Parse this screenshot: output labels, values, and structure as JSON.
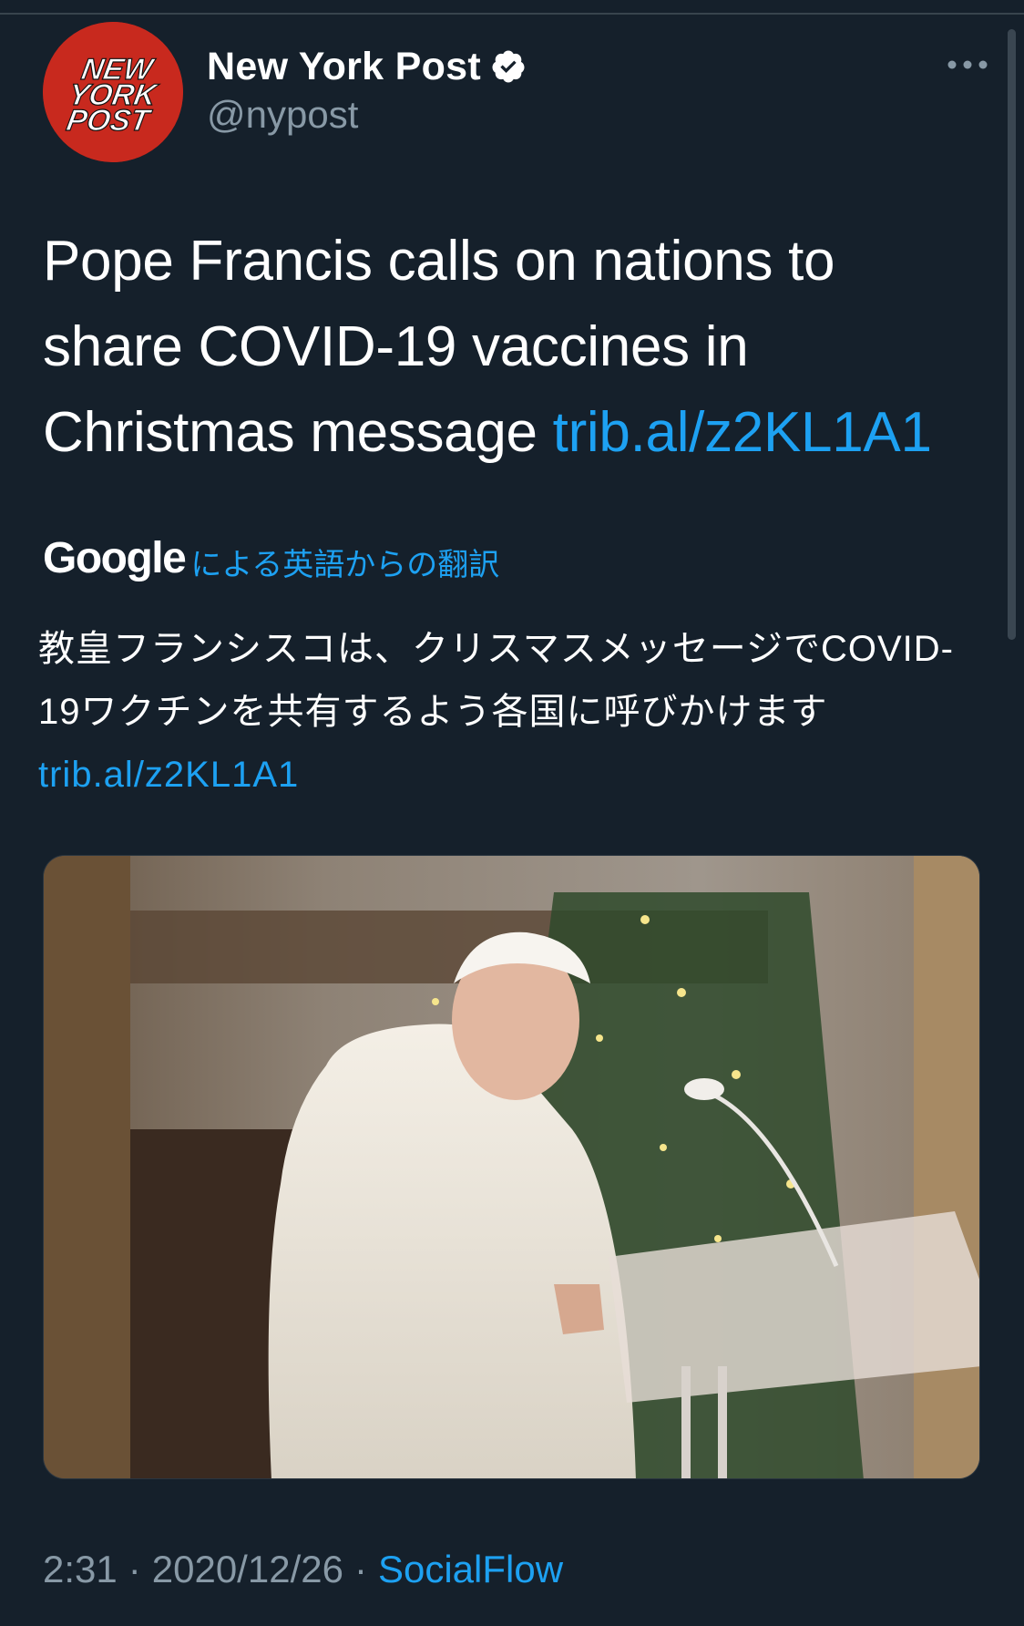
{
  "account": {
    "display_name": "New York Post",
    "handle": "@nypost",
    "avatar_logo_text": [
      "NEW",
      "YORK",
      "POST"
    ],
    "verified": true
  },
  "tweet": {
    "text": "Pope Francis calls on nations to share COVID-19 vaccines in Christmas message ",
    "link": "trib.al/z2KL1A1"
  },
  "translation": {
    "provider": "Google",
    "label": "による英語からの翻訳",
    "text": "教皇フランシスコは、クリスマスメッセージでCOVID-19ワクチンを共有するよう各国に呼びかけます",
    "link": "trib.al/z2KL1A1"
  },
  "meta": {
    "time": "2:31",
    "date": "2020/12/26",
    "separator": "·",
    "source": "SocialFlow"
  },
  "icons": {
    "verified": "verified-badge-icon",
    "more": "more-options-icon"
  },
  "colors": {
    "background": "#15202b",
    "link": "#1da1f2",
    "secondary_text": "#8899a6",
    "avatar_red": "#c8291e"
  }
}
